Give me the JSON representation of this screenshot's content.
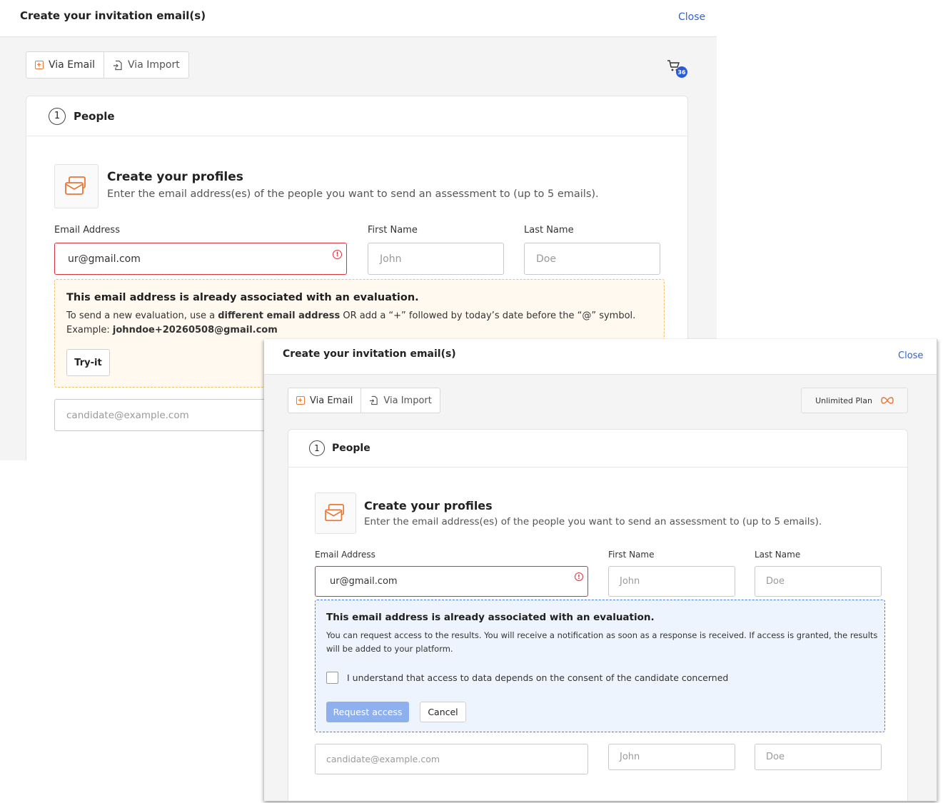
{
  "dialog_back": {
    "title": "Create your invitation email(s)",
    "close_label": "Close",
    "tabs": {
      "via_email": "Via Email",
      "via_import": "Via Import"
    },
    "cart_count": "36",
    "section": {
      "number": "1",
      "label": "People"
    },
    "profiles": {
      "title": "Create your profiles",
      "description": "Enter the email address(es) of the people you want to send an assessment to (up to 5 emails)."
    },
    "fields": {
      "email_label": "Email Address",
      "first_name_label": "First Name",
      "last_name_label": "Last Name",
      "row1": {
        "email_value": "ur@gmail.com",
        "first_name_placeholder": "John",
        "last_name_placeholder": "Doe"
      },
      "row2": {
        "email_placeholder": "candidate@example.com"
      }
    },
    "warning": {
      "title": "This email address is already associated with an evaluation.",
      "line1_part1": "To send a new evaluation, use a ",
      "line1_bold": "different email address",
      "line1_part2": " OR add a “+” followed by today’s date before the “@” symbol.",
      "example_label": "Example: ",
      "example_value": "johndoe+20260508@gmail.com",
      "button": "Try-it"
    }
  },
  "dialog_front": {
    "title": "Create your invitation email(s)",
    "close_label": "Close",
    "tabs": {
      "via_email": "Via Email",
      "via_import": "Via Import"
    },
    "plan_label": "Unlimited Plan",
    "section": {
      "number": "1",
      "label": "People"
    },
    "profiles": {
      "title": "Create your profiles",
      "description": "Enter the email address(es) of the people you want to send an assessment to (up to 5 emails)."
    },
    "fields": {
      "email_label": "Email Address",
      "first_name_label": "First Name",
      "last_name_label": "Last Name",
      "row1": {
        "email_value": "ur@gmail.com",
        "first_name_placeholder": "John",
        "last_name_placeholder": "Doe"
      },
      "row2": {
        "email_placeholder": "candidate@example.com",
        "first_name_placeholder": "John",
        "last_name_placeholder": "Doe"
      }
    },
    "info": {
      "title": "This email address is already associated with an evaluation.",
      "body": "You can request access to the results. You will receive a notification as soon as a response is received. If access is granted, the results will be added to your platform.",
      "consent_label": "I understand that access to data depends on the consent of the candidate concerned",
      "request_button": "Request access",
      "cancel_button": "Cancel"
    }
  },
  "colors": {
    "accent_orange": "#e8773a",
    "link_blue": "#2f62d4",
    "error_red": "#d9333f",
    "primary_disabled": "#8fb0ef"
  }
}
